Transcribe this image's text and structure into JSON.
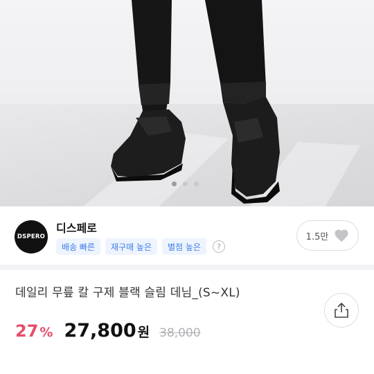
{
  "gallery": {
    "image_alt": "product-photo-black-jeans-sneakers",
    "page_count": 3,
    "active_index": 0
  },
  "seller": {
    "logo_text": "DSPERO",
    "name": "디스페로",
    "badges": [
      "배송 빠른",
      "재구매 높은",
      "별점 높은"
    ],
    "help_label": "?",
    "likes": "1.5만"
  },
  "product": {
    "title": "데일리 무릎 칼 구제 블랙 슬림 데님_(S~XL)",
    "discount_value": "27",
    "discount_unit": "%",
    "price": "27,800",
    "currency": "원",
    "original_price": "38,000"
  },
  "colors": {
    "discount": "#e54d6b",
    "badge_text": "#3b7be8",
    "badge_bg": "#eef4fe",
    "original_price": "#b0b0b4"
  }
}
